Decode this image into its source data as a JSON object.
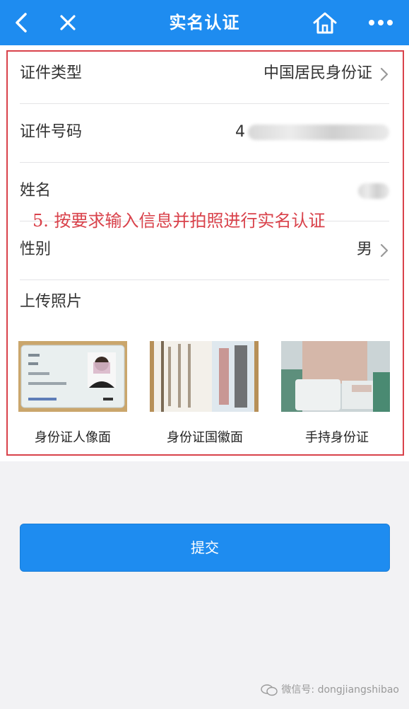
{
  "header": {
    "title": "实名认证",
    "icons": [
      "back-arrow-icon",
      "close-icon",
      "home-icon",
      "more-icon"
    ],
    "background": "#1e8cf0"
  },
  "form": {
    "id_type": {
      "label": "证件类型",
      "value": "中国居民身份证"
    },
    "id_number": {
      "label": "证件号码",
      "value": "4"
    },
    "name": {
      "label": "姓名"
    },
    "gender": {
      "label": "性别",
      "value": "男"
    },
    "upload": {
      "label": "上传照片",
      "photos": [
        {
          "caption": "身份证人像面"
        },
        {
          "caption": "身份证国徽面"
        },
        {
          "caption": "手持身份证"
        }
      ]
    }
  },
  "annotation": "5. 按要求输入信息并拍照进行实名认证",
  "annotation_color": "#d9424b",
  "submit_label": "提交",
  "watermark": "微信号: dongjiangshibao"
}
